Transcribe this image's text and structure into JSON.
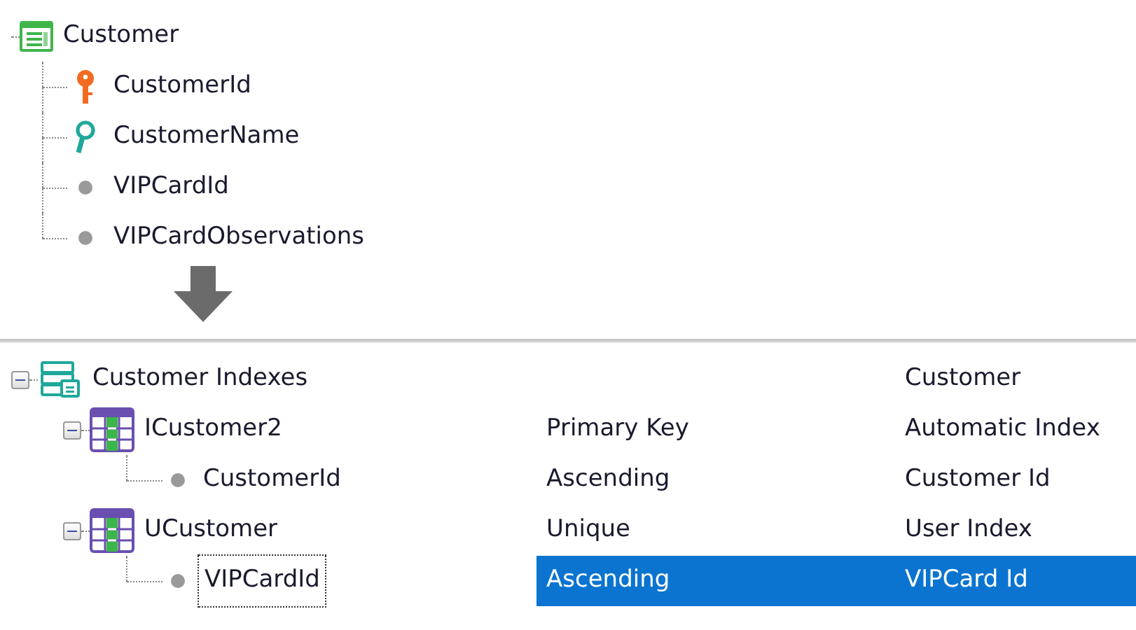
{
  "structure": {
    "name": "Customer",
    "attributes": [
      {
        "name": "CustomerId",
        "kind": "key"
      },
      {
        "name": "CustomerName",
        "kind": "description"
      },
      {
        "name": "VIPCardId",
        "kind": "plain"
      },
      {
        "name": "VIPCardObservations",
        "kind": "plain"
      }
    ]
  },
  "indexes": {
    "name": "Customer Indexes",
    "column_3": "Customer",
    "expanded": true,
    "selected": false,
    "kind": "group",
    "children": [
      {
        "name": "ICustomer2",
        "column_2": "Primary Key",
        "column_3": "Automatic Index",
        "expanded": true,
        "selected": false,
        "kind": "index",
        "children": [
          {
            "name": "CustomerId",
            "column_2": "Ascending",
            "column_3": "Customer Id",
            "selected": false,
            "kind": "attribute"
          }
        ]
      },
      {
        "name": "UCustomer",
        "column_2": "Unique",
        "column_3": "User Index",
        "expanded": true,
        "selected": false,
        "kind": "index",
        "children": [
          {
            "name": "VIPCardId",
            "column_2": "Ascending",
            "column_3": "VIPCard Id",
            "selected": true,
            "kind": "attribute"
          }
        ]
      }
    ]
  }
}
